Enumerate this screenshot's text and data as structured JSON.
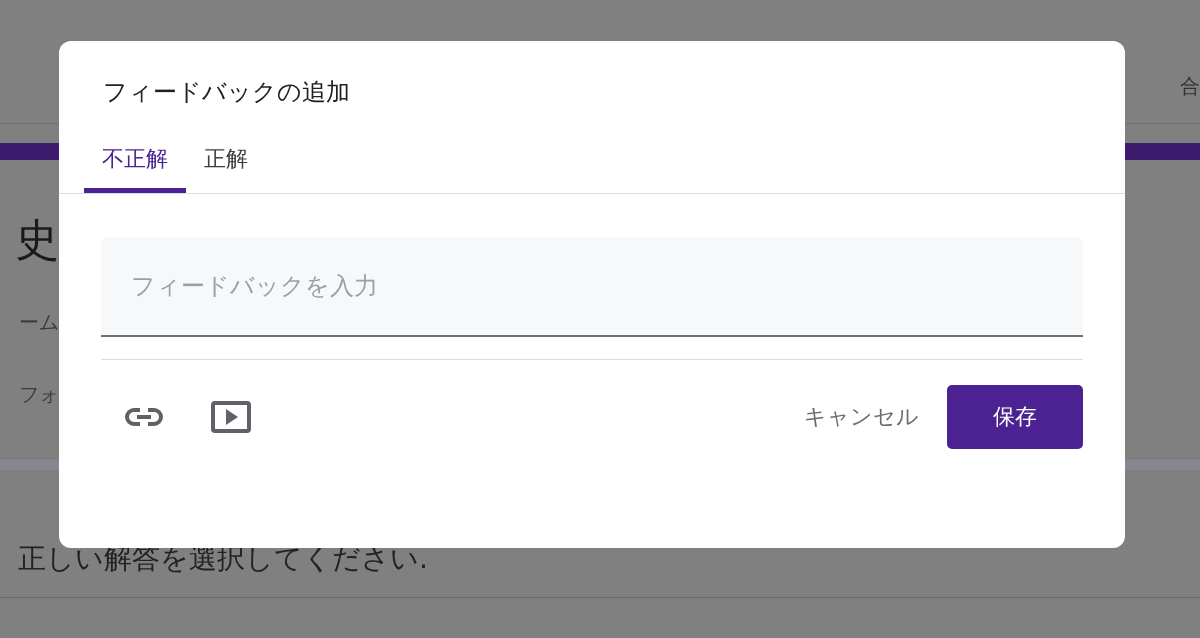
{
  "page": {
    "header_text": "合",
    "title": "史",
    "lines": [
      "ーム",
      "フォ"
    ],
    "question": "正しい解答を選択してください."
  },
  "dialog": {
    "title": "フィードバックの追加",
    "tabs": [
      {
        "label": "不正解",
        "selected": true
      },
      {
        "label": "正解",
        "selected": false
      }
    ],
    "feedback_field": {
      "placeholder": "フィードバックを入力"
    },
    "cancel_button": "キャンセル",
    "save_button": "保存"
  }
}
